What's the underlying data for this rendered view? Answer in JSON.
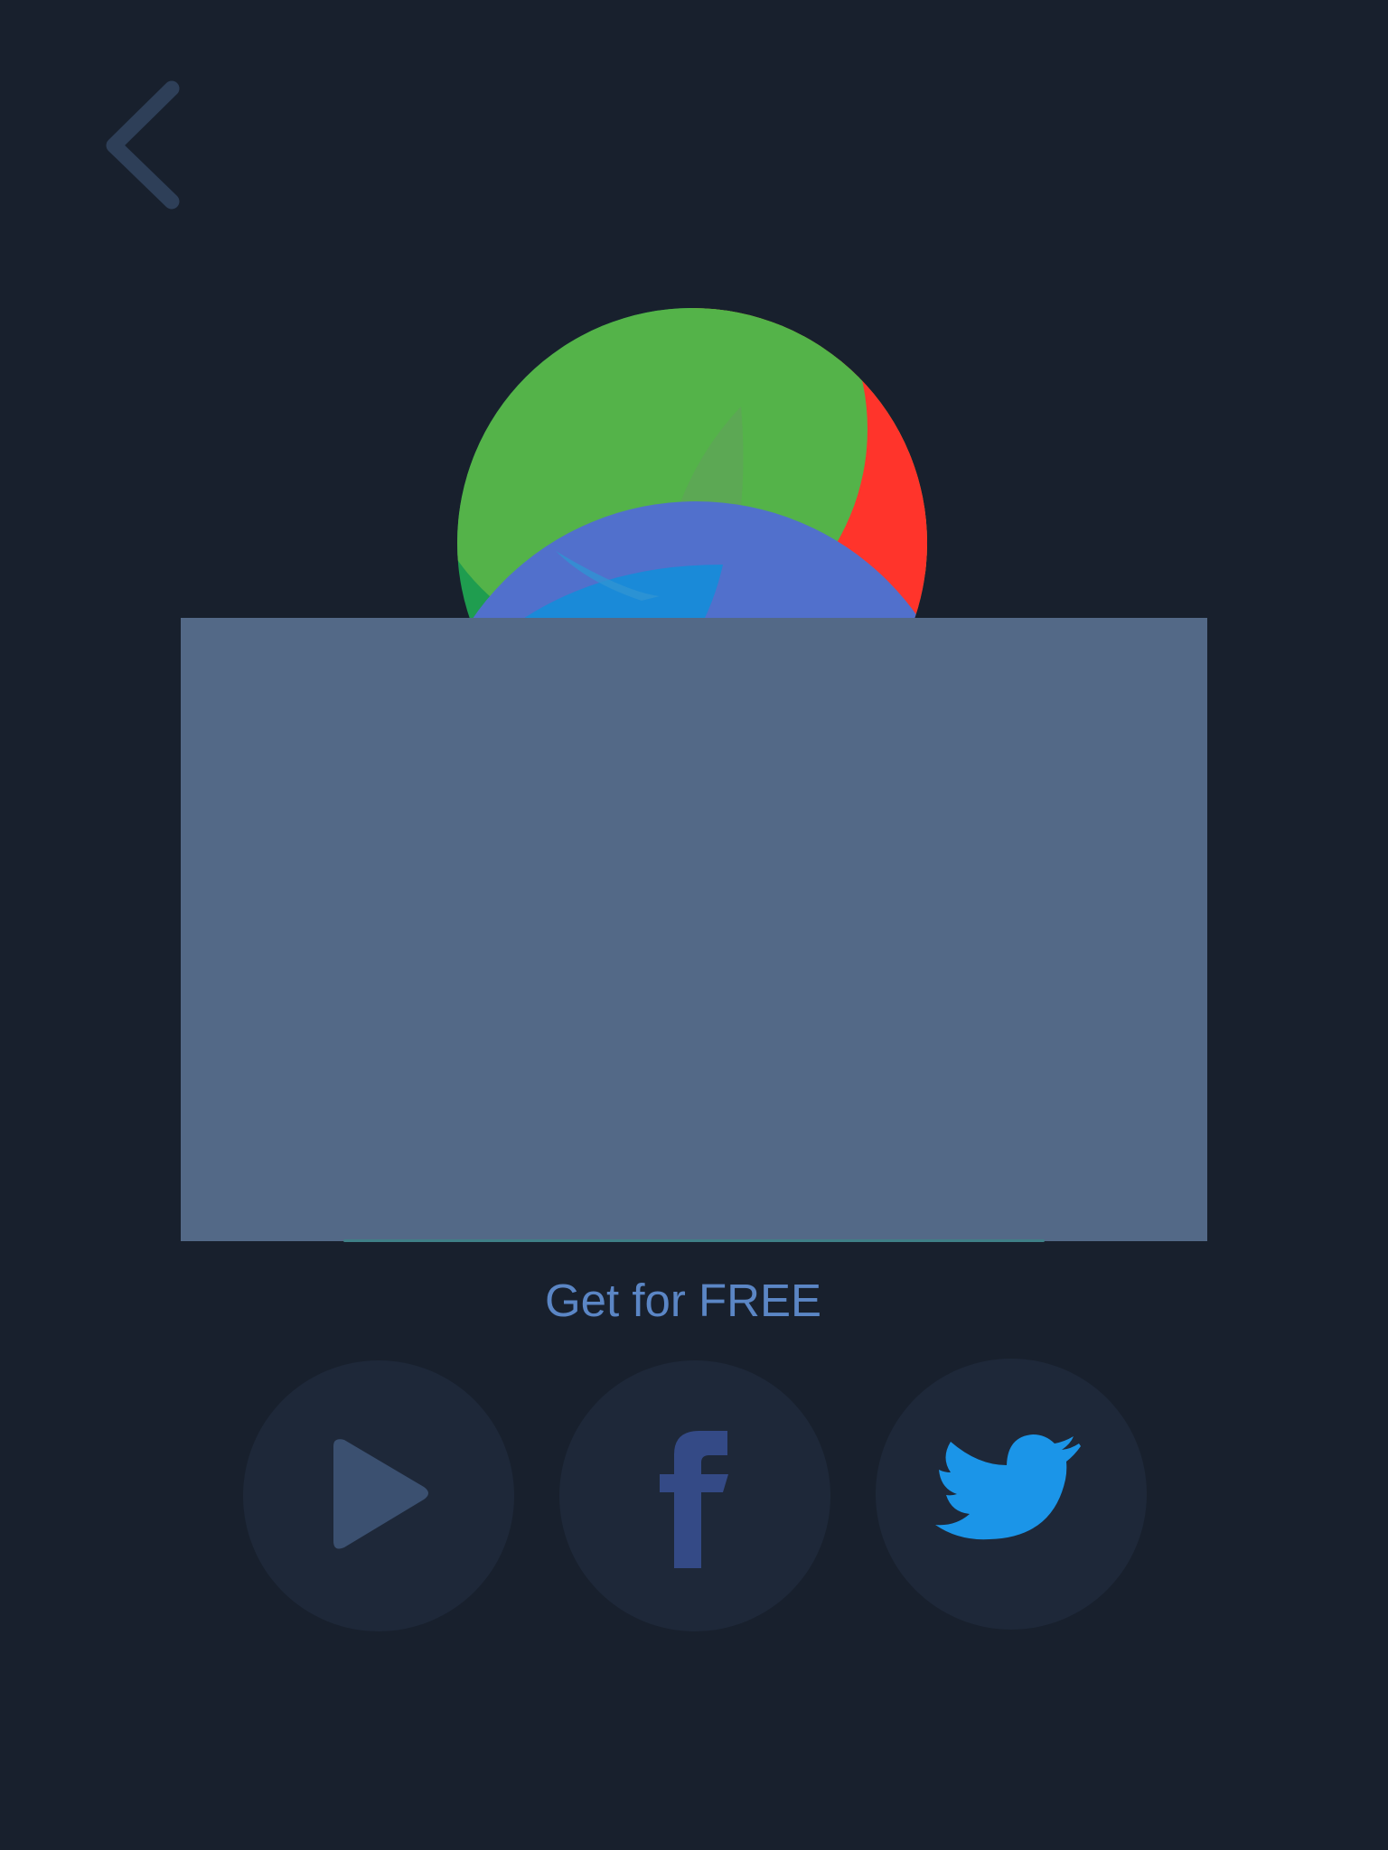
{
  "header": {
    "back_icon": "chevron-left-icon"
  },
  "logo": {
    "icon": "colorful-ball-logo-icon",
    "colors": {
      "green": "#54b349",
      "dark_green": "#1f9d4f",
      "orange": "#de7f0e",
      "red": "#ff342b",
      "purple_blue": "#5170cc",
      "blue": "#1a8ad8"
    }
  },
  "panel": {
    "color": "#536987"
  },
  "cta": {
    "label": "Get for FREE",
    "color": "#5b86c5"
  },
  "share": {
    "buttons": [
      {
        "icon": "play-store-icon",
        "color": "#3b5070"
      },
      {
        "icon": "facebook-icon",
        "color": "#344a86"
      },
      {
        "icon": "twitter-icon",
        "color": "#1b95e8"
      }
    ]
  },
  "colors": {
    "background": "#18202d",
    "button_circle": "#1e2839"
  }
}
